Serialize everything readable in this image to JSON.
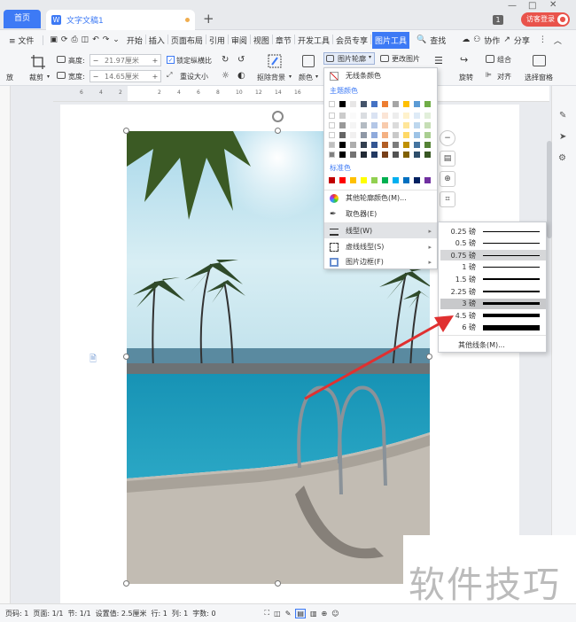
{
  "tabs": {
    "home": "首页",
    "doc": "文字文稿1",
    "new": "+"
  },
  "window": {
    "badge": "1",
    "login": "访客登录"
  },
  "menu": {
    "file": "≡ 文件",
    "items": [
      "开始",
      "插入",
      "页面布局",
      "引用",
      "审阅",
      "视图",
      "章节",
      "开发工具",
      "会员专享"
    ],
    "active": "图片工具",
    "search": "查找",
    "collab": "协作",
    "share": "分享"
  },
  "ribbon": {
    "crop": "裁剪",
    "height_label": "高度:",
    "height_value": "21.97厘米",
    "width_label": "宽度:",
    "width_value": "14.65厘米",
    "lock_ratio": "锁定纵横比",
    "reset_size": "重设大小",
    "remove_bg": "抠除背景",
    "color": "颜色",
    "outline": "图片轮廓",
    "change_pic": "更改图片",
    "rotate": "旋转",
    "align": "对齐",
    "group": "组合",
    "select_pane": "选择窗格",
    "left_cut": "放"
  },
  "ruler_ticks": [
    "6",
    "4",
    "2",
    "2",
    "4",
    "6",
    "8",
    "10",
    "12",
    "14",
    "16"
  ],
  "outline_menu": {
    "no_outline": "无线条颜色",
    "theme_colors": "主题颜色",
    "standard_colors": "标准色",
    "other_colors": "其他轮廓颜色(M)...",
    "eyedropper": "取色器(E)",
    "line_type": "线型(W)",
    "dash_type": "虚线线型(S)",
    "border": "图片边框(F)"
  },
  "theme_palette": {
    "top": [
      "#ffffff",
      "#000000",
      "#e7e6e6",
      "#44546a",
      "#4472c4",
      "#ed7d31",
      "#a5a5a5",
      "#ffc000",
      "#5b9bd5",
      "#70ad47"
    ]
  },
  "standard_palette": [
    "#c00000",
    "#ff0000",
    "#ffc000",
    "#ffff00",
    "#92d050",
    "#00b050",
    "#00b0f0",
    "#0070c0",
    "#002060",
    "#7030a0"
  ],
  "line_weights": [
    {
      "label": "0.25 磅",
      "w": 1
    },
    {
      "label": "0.5 磅",
      "w": 1
    },
    {
      "label": "0.75 磅",
      "w": 1,
      "selected": true
    },
    {
      "label": "1 磅",
      "w": 1
    },
    {
      "label": "1.5 磅",
      "w": 2
    },
    {
      "label": "2.25 磅",
      "w": 2
    },
    {
      "label": "3 磅",
      "w": 3,
      "hover": true
    },
    {
      "label": "4.5 磅",
      "w": 4
    },
    {
      "label": "6 磅",
      "w": 6
    }
  ],
  "other_lines": "其他线条(M)...",
  "status": {
    "page": "页码: 1",
    "pages": "页面: 1/1",
    "section": "节: 1/1",
    "setting": "设置值: 2.5厘米",
    "row": "行: 1",
    "col": "列: 1",
    "words": "字数: 0"
  },
  "watermark": "软件技巧",
  "colors": {
    "accent": "#3d7af5",
    "login": "#e9534b",
    "arrow": "#e03030"
  }
}
